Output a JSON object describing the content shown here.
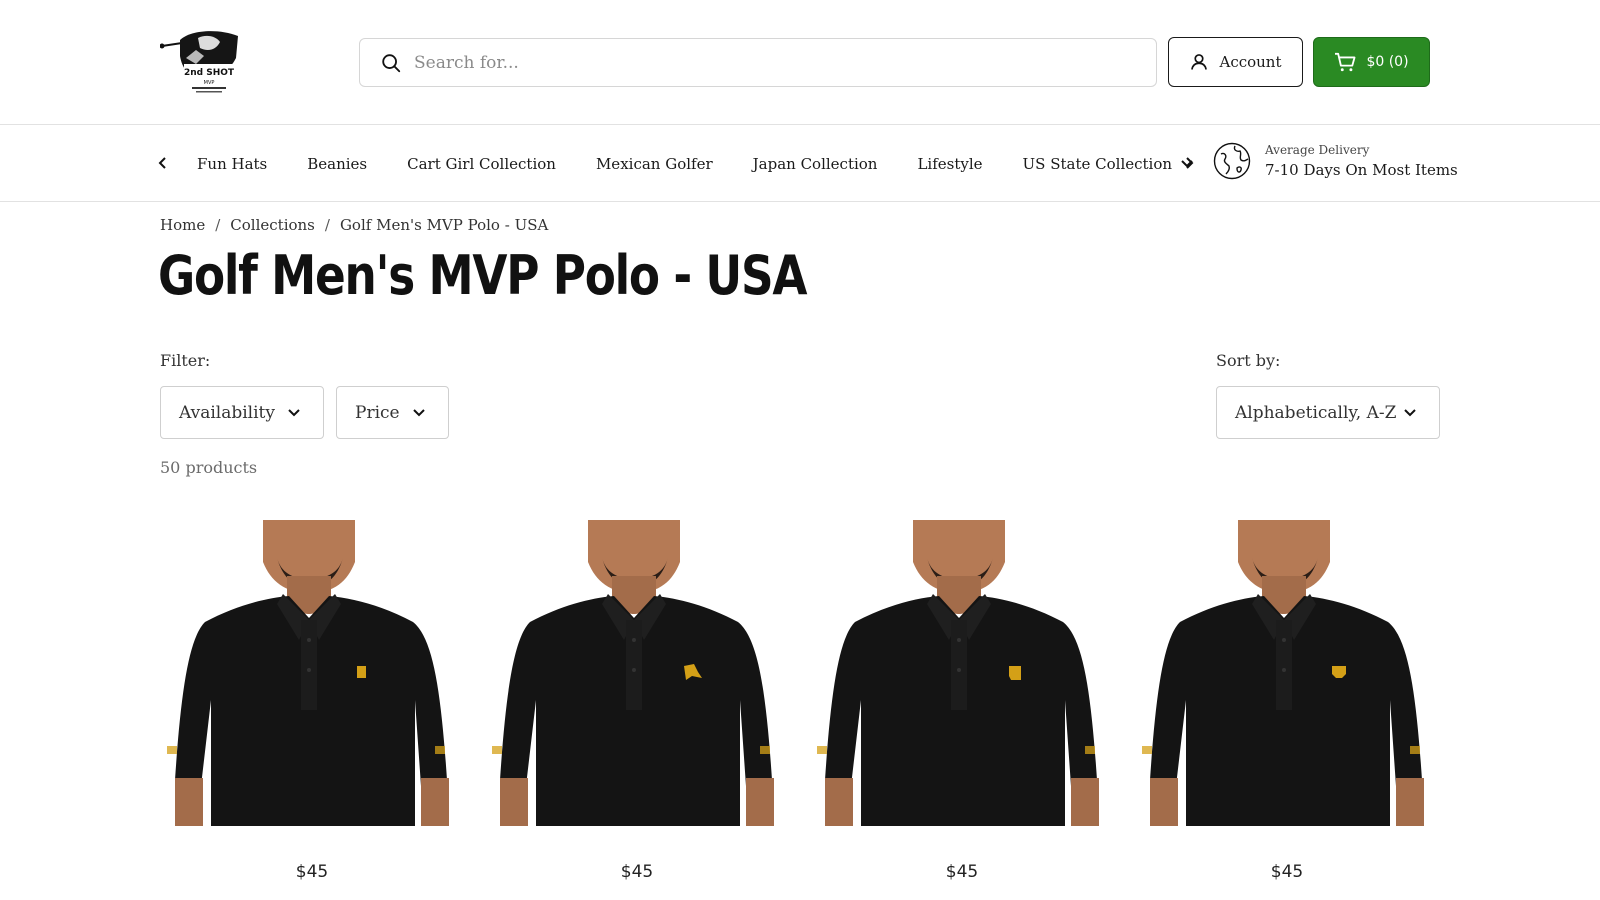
{
  "brand": {
    "logo_text_line1": "2nd SHOT",
    "logo_text_line2": "MVP"
  },
  "header": {
    "search_placeholder": "Search for...",
    "account_label": "Account",
    "cart_label": "$0 (0)"
  },
  "colors": {
    "cart_green": "#2a8a23",
    "text_dark": "#1a1a1a",
    "shirt_black": "#141414",
    "emblem_gold": "#d4a017"
  },
  "nav": {
    "items": [
      {
        "label": "Fun Hats"
      },
      {
        "label": "Beanies"
      },
      {
        "label": "Cart Girl Collection"
      },
      {
        "label": "Mexican Golfer"
      },
      {
        "label": "Japan Collection"
      },
      {
        "label": "Lifestyle"
      },
      {
        "label": "US State Collection"
      }
    ],
    "delivery_small": "Average Delivery",
    "delivery_main": "7-10 Days On Most Items"
  },
  "breadcrumb": {
    "home": "Home",
    "collections": "Collections",
    "current": "Golf Men's MVP Polo - USA",
    "separator": "/"
  },
  "page": {
    "title": "Golf Men's MVP Polo - USA",
    "filter_label": "Filter:",
    "sort_label": "Sort by:",
    "availability": "Availability",
    "price_filter": "Price",
    "sort_value": "Alphabetically, A-Z",
    "product_count": "50 products"
  },
  "products": [
    {
      "price": "$45"
    },
    {
      "price": "$45"
    },
    {
      "price": "$45"
    },
    {
      "price": "$45"
    }
  ]
}
